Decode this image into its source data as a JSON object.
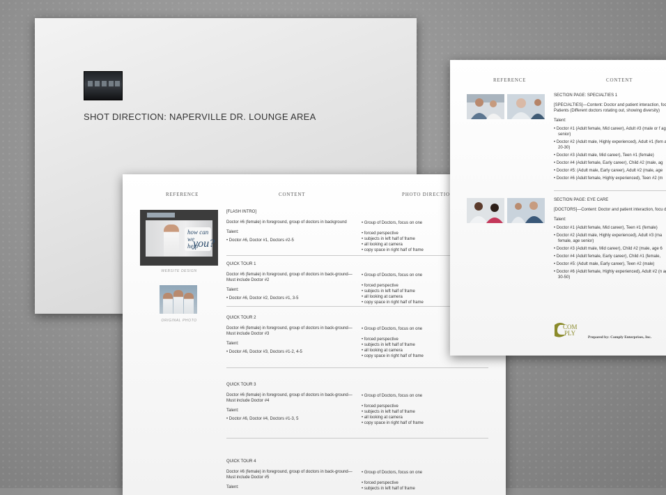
{
  "back_sheet": {
    "title": "SHOT DIRECTION: NAPERVILLE DR. LOUNGE AREA"
  },
  "mid_sheet": {
    "headers": {
      "reference": "REFERENCE",
      "content": "CONTENT",
      "photo_direction": "PHOTO DIRECTION"
    },
    "website_overlay": {
      "line1": "how can we",
      "line1b": "help",
      "big": "you?"
    },
    "captions": {
      "website": "WEBSITE DESIGN",
      "original": "ORIGINAL PHOTO"
    },
    "sections": [
      {
        "title": "[FLASH INTRO]",
        "description": "Doctor #6 (female) in foreground, group of doctors in background",
        "talent_label": "Talent:",
        "talent": "• Doctor #6, Doctor #1, Doctors #2-5",
        "direction_main": "• Group of Doctors, focus on one",
        "direction_items": [
          "• forced perspective",
          "• subjects in left half of frame",
          "• all looking at camera",
          "• copy space in right half of frame"
        ]
      },
      {
        "title": "QUICK TOUR 1",
        "description": "Doctor #6 (female) in foreground, group of doctors in back-ground—Must include Doctor #2",
        "talent_label": "Talent:",
        "talent": "• Doctor #6, Doctor #2, Doctors #1, 3-5",
        "direction_main": "• Group of Doctors, focus on one",
        "direction_items": [
          "• forced perspective",
          "• subjects in left half of frame",
          "• all looking at camera",
          "• copy space in right half of frame"
        ]
      },
      {
        "title": "QUICK TOUR 2",
        "description": "Doctor #6 (female) in foreground, group of doctors in back-ground—Must include Doctor #3",
        "talent_label": "Talent:",
        "talent": "• Doctor #6, Doctor #3, Doctors #1-2, 4-5",
        "direction_main": "• Group of Doctors, focus on one",
        "direction_items": [
          "• forced perspective",
          "• subjects in left half of frame",
          "• all looking at camera",
          "• copy space in right half of frame"
        ]
      },
      {
        "title": "QUICK TOUR 3",
        "description": "Doctor #6 (female) in foreground, group of doctors in back-ground—Must include Doctor #4",
        "talent_label": "Talent:",
        "talent": "• Doctor #6, Doctor #4, Doctors #1-3, 5",
        "direction_main": "• Group of Doctors, focus on one",
        "direction_items": [
          "• forced perspective",
          "• subjects in left half of frame",
          "• all looking at camera",
          "• copy space in right half of frame"
        ]
      },
      {
        "title": "QUICK TOUR 4",
        "description": "Doctor #6 (female) in foreground, group of doctors in back-ground—Must include Doctor #5",
        "talent_label": "Talent:",
        "talent": "",
        "direction_main": "• Group of Doctors, focus on one",
        "direction_items": [
          "• forced perspective",
          "• subjects in left half of frame"
        ]
      }
    ]
  },
  "right_sheet": {
    "headers": {
      "reference": "REFERENCE",
      "content": "CONTENT"
    },
    "sections": [
      {
        "title": "SECTION PAGE: SPECIALTIES 1",
        "description": "[SPECIALTIES]—Content: Doctor and patient interaction, foc Patients (Different doctors rotating out, showing diversity)",
        "talent_label": "Talent:",
        "items": [
          "• Doctor #1 (Adult female, Mid career), Adult #3 (male or f age senior)",
          "• Doctor #2 (Adult male, Highly experienced), Adult #1 (fem age 20-30)",
          "• Doctor #3 (Adult male, Mid career), Teen #1 (female)",
          "• Doctor #4 (Adult female, Early career), Child #2 (male, ag",
          "• Doctor #5: (Adult male, Early career), Adult #2 (male, age",
          "• Doctor #6 (Adult female, Highly experienced), Teen #2 (m"
        ]
      },
      {
        "title": "SECTION PAGE: EYE CARE",
        "description": "[DOCTORS]—Content: Doctor and patient interaction, focu doctor",
        "talent_label": "Talent:",
        "items": [
          "• Doctor #1 (Adult female, Mid career), Teen #1 (female)",
          "• Doctor #2 (Adult male, Highly experienced), Adult #3 (ma female, age senior)",
          "• Doctor #3 (Adult male, Mid career), Child #2 (male, age 6",
          "• Doctor #4 (Adult female, Early career), Child #1 (female,",
          "• Doctor #5: (Adult male, Early career), Teen #2 (male)",
          "• Doctor #6 (Adult female, Highly experienced), Adult #2 (n age 30-50)"
        ]
      }
    ],
    "logo_text_top": "COM",
    "logo_text_bottom": "PLY",
    "prepared_by": "Prepared by: Comply Enterprises, Inc."
  },
  "colors": {
    "background": "#8e8e8e",
    "paper": "#f4f4f4",
    "logo": "#8a8a2a",
    "website_accent": "#2b4a6a"
  }
}
